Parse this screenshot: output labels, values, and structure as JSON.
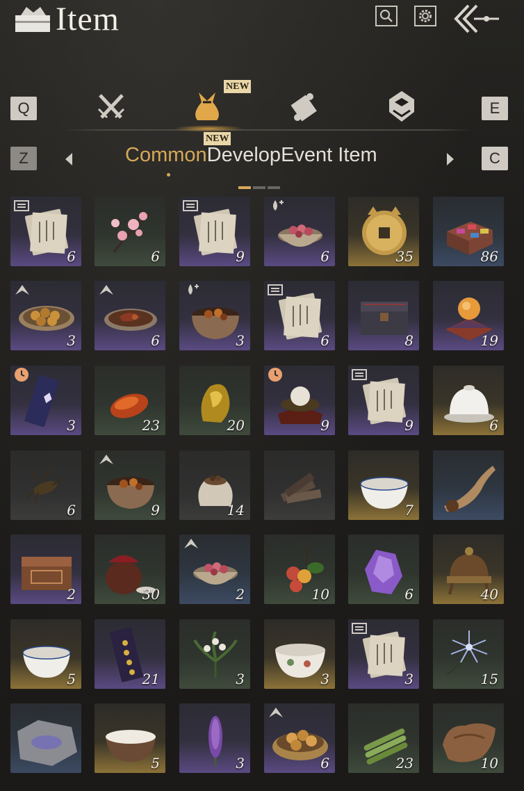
{
  "header": {
    "title": "Item"
  },
  "tabs": {
    "keys": {
      "prev": "Q",
      "next": "E",
      "sub_prev": "Z",
      "sub_next": "C"
    },
    "categories": [
      {
        "name": "weapons",
        "icon": "crossed-swords-icon"
      },
      {
        "name": "items",
        "icon": "pouch-icon",
        "active": true,
        "badge": "NEW"
      },
      {
        "name": "scrolls",
        "icon": "scroll-icon"
      },
      {
        "name": "gems",
        "icon": "gem-icon"
      }
    ],
    "subtabs": [
      {
        "label": "Common",
        "active": true
      },
      {
        "label": "Develop",
        "badge": "NEW"
      },
      {
        "label": "Event Item"
      }
    ],
    "page_indicator": {
      "pages": 3,
      "current": 1
    }
  },
  "items": [
    {
      "qty": "6",
      "rarity": "purple",
      "tag": "book-icon",
      "art": "paper"
    },
    {
      "qty": "6",
      "rarity": "green",
      "tag": "",
      "art": "blossom"
    },
    {
      "qty": "9",
      "rarity": "purple",
      "tag": "book-icon",
      "art": "paper"
    },
    {
      "qty": "6",
      "rarity": "purple",
      "tag": "drop-icon",
      "art": "bowl-red"
    },
    {
      "qty": "35",
      "rarity": "gold",
      "tag": "",
      "art": "coin"
    },
    {
      "qty": "86",
      "rarity": "blue",
      "tag": "",
      "art": "box-color"
    },
    {
      "qty": "3",
      "rarity": "purple",
      "tag": "up-icon",
      "art": "plate-balls"
    },
    {
      "qty": "6",
      "rarity": "purple",
      "tag": "up-icon",
      "art": "plate-meat"
    },
    {
      "qty": "3",
      "rarity": "purple",
      "tag": "drop-icon",
      "art": "pot-stew"
    },
    {
      "qty": "6",
      "rarity": "purple",
      "tag": "book-icon",
      "art": "paper"
    },
    {
      "qty": "8",
      "rarity": "purple",
      "tag": "",
      "art": "chest"
    },
    {
      "qty": "19",
      "rarity": "purple",
      "tag": "",
      "art": "orb"
    },
    {
      "qty": "3",
      "rarity": "purple",
      "tag": "clock-icon",
      "art": "banner"
    },
    {
      "qty": "23",
      "rarity": "green",
      "tag": "",
      "art": "red-stone"
    },
    {
      "qty": "20",
      "rarity": "green",
      "tag": "",
      "art": "gold-ore"
    },
    {
      "qty": "9",
      "rarity": "purple",
      "tag": "clock-icon",
      "art": "pearl"
    },
    {
      "qty": "9",
      "rarity": "purple",
      "tag": "book-icon",
      "art": "paper"
    },
    {
      "qty": "6",
      "rarity": "gold",
      "tag": "",
      "art": "white-bowl-lid"
    },
    {
      "qty": "6",
      "rarity": "gray",
      "tag": "",
      "art": "cricket"
    },
    {
      "qty": "9",
      "rarity": "green",
      "tag": "up-icon",
      "art": "pot-stew"
    },
    {
      "qty": "14",
      "rarity": "gray",
      "tag": "",
      "art": "sack"
    },
    {
      "qty": "",
      "rarity": "gray",
      "tag": "",
      "art": "wood"
    },
    {
      "qty": "7",
      "rarity": "gold",
      "tag": "",
      "art": "white-bowl"
    },
    {
      "qty": "",
      "rarity": "blue",
      "tag": "",
      "art": "horn"
    },
    {
      "qty": "2",
      "rarity": "purple",
      "tag": "",
      "art": "chest-wood"
    },
    {
      "qty": "30",
      "rarity": "green",
      "tag": "",
      "art": "jar"
    },
    {
      "qty": "2",
      "rarity": "blue",
      "tag": "up-icon",
      "art": "bowl-red"
    },
    {
      "qty": "10",
      "rarity": "green",
      "tag": "",
      "art": "lychee"
    },
    {
      "qty": "6",
      "rarity": "green",
      "tag": "",
      "art": "amethyst"
    },
    {
      "qty": "40",
      "rarity": "gold",
      "tag": "",
      "art": "helmet"
    },
    {
      "qty": "5",
      "rarity": "gold",
      "tag": "",
      "art": "white-bowl"
    },
    {
      "qty": "21",
      "rarity": "purple",
      "tag": "",
      "art": "banner-gold"
    },
    {
      "qty": "3",
      "rarity": "green",
      "tag": "",
      "art": "orchid"
    },
    {
      "qty": "3",
      "rarity": "gold",
      "tag": "",
      "art": "porcelain-bowl"
    },
    {
      "qty": "3",
      "rarity": "purple",
      "tag": "book-icon",
      "art": "paper"
    },
    {
      "qty": "15",
      "rarity": "green",
      "tag": "",
      "art": "flower-blue"
    },
    {
      "qty": "",
      "rarity": "blue",
      "tag": "",
      "art": "stone-slab"
    },
    {
      "qty": "5",
      "rarity": "gold",
      "tag": "",
      "art": "milk-bowl"
    },
    {
      "qty": "3",
      "rarity": "purple",
      "tag": "",
      "art": "lavender"
    },
    {
      "qty": "6",
      "rarity": "purple",
      "tag": "up-icon",
      "art": "basket-bread"
    },
    {
      "qty": "23",
      "rarity": "green",
      "tag": "",
      "art": "bamboo"
    },
    {
      "qty": "10",
      "rarity": "green",
      "tag": "",
      "art": "fur"
    }
  ]
}
